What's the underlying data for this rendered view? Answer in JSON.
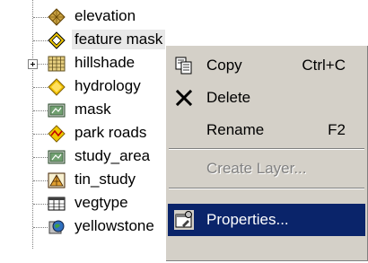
{
  "tree": {
    "items": [
      {
        "label": "elevation",
        "icon": "raster-layer-icon"
      },
      {
        "label": "feature mask",
        "icon": "polygon-layer-icon",
        "selected": true
      },
      {
        "label": "hillshade",
        "icon": "grid-layer-icon",
        "expandable": true
      },
      {
        "label": "hydrology",
        "icon": "point-layer-icon"
      },
      {
        "label": "mask",
        "icon": "image-layer-icon"
      },
      {
        "label": "park roads",
        "icon": "line-layer-icon"
      },
      {
        "label": "study_area",
        "icon": "image-layer-icon"
      },
      {
        "label": "tin_study",
        "icon": "tin-layer-icon"
      },
      {
        "label": "vegtype",
        "icon": "table-icon"
      },
      {
        "label": "yellowstone",
        "icon": "coverage-icon"
      }
    ]
  },
  "context_menu": {
    "copy": {
      "label": "Copy",
      "shortcut": "Ctrl+C",
      "icon": "copy-icon"
    },
    "delete": {
      "label": "Delete",
      "icon": "delete-icon"
    },
    "rename": {
      "label": "Rename",
      "shortcut": "F2"
    },
    "create_layer": {
      "label": "Create Layer...",
      "disabled": true
    },
    "properties": {
      "label": "Properties...",
      "icon": "properties-icon",
      "highlighted": true
    }
  },
  "colors": {
    "menu_background": "#d4d0c8",
    "highlight": "#0a246a",
    "selection": "#e8e8e8"
  }
}
